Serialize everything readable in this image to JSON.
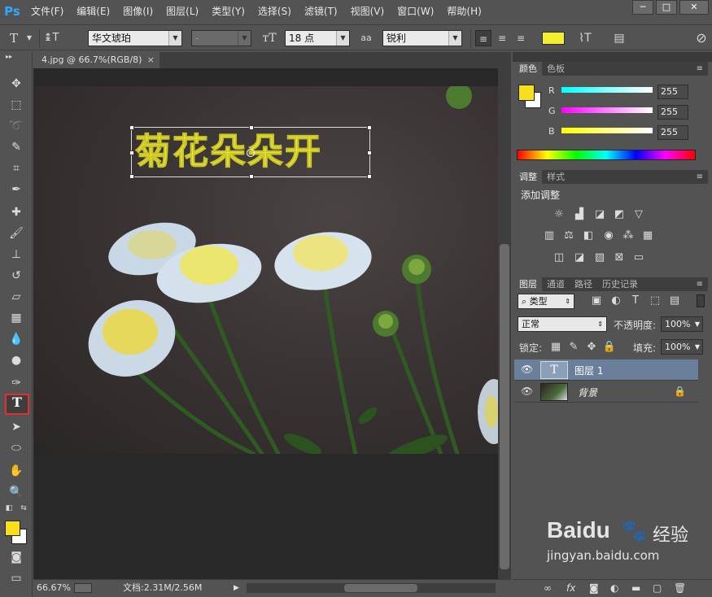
{
  "app": {
    "logo": "Ps"
  },
  "menu": [
    "文件(F)",
    "编辑(E)",
    "图像(I)",
    "图层(L)",
    "类型(Y)",
    "选择(S)",
    "滤镜(T)",
    "视图(V)",
    "窗口(W)",
    "帮助(H)"
  ],
  "options": {
    "font_family": "华文琥珀",
    "font_style": "-",
    "font_size": "18 点",
    "antialias_icon_label": "aa",
    "antialias": "锐利",
    "text_color": "#f2ee32"
  },
  "document": {
    "tab_title": "4.jpg @ 66.7%(RGB/8)",
    "text_layer_content": "菊花朵朵开",
    "text_color": "#f2ee32"
  },
  "status": {
    "zoom": "66.67%",
    "doc_size": "文档:2.31M/2.56M"
  },
  "color_panel": {
    "tabs": [
      "颜色",
      "色板"
    ],
    "channels": [
      {
        "label": "R",
        "value": "255"
      },
      {
        "label": "G",
        "value": "255"
      },
      {
        "label": "B",
        "value": "255"
      }
    ],
    "foreground": "#f7e01a",
    "background": "#ffffff"
  },
  "adjust_panel": {
    "tabs": [
      "调整",
      "样式"
    ],
    "title": "添加调整"
  },
  "layers_panel": {
    "tabs": [
      "图层",
      "通道",
      "路径",
      "历史记录"
    ],
    "filter": "类型",
    "blend_mode": "正常",
    "opacity_label": "不透明度:",
    "opacity": "100%",
    "lock_label": "锁定:",
    "fill_label": "填充:",
    "fill": "100%",
    "layers": [
      {
        "name": "图层 1",
        "type": "text",
        "selected": true
      },
      {
        "name": "背景",
        "type": "image",
        "locked": true
      }
    ]
  },
  "watermark": {
    "brand": "Baidu",
    "cn": "经验",
    "url": "jingyan.baidu.com"
  }
}
